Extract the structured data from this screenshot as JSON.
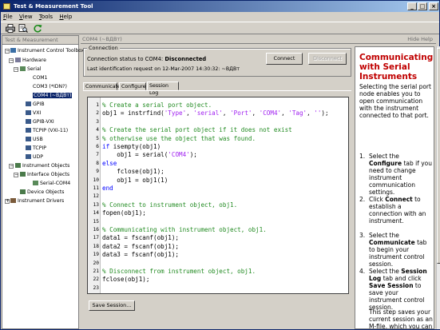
{
  "window": {
    "title": "Test & Measurement Tool",
    "controls": [
      "_",
      "□",
      "×"
    ]
  },
  "menu": [
    {
      "accel": "F",
      "rest": "ile"
    },
    {
      "accel": "V",
      "rest": "iew"
    },
    {
      "accel": "T",
      "rest": "ools"
    },
    {
      "accel": "H",
      "rest": "elp"
    }
  ],
  "toolbar": {
    "icons": [
      "print-icon",
      "print-preview-icon",
      "refresh-icon"
    ]
  },
  "left_panel": {
    "title": "Test & Measurement",
    "tree": {
      "root": "Instrument Control Toolbox",
      "hardware": "Hardware",
      "serial": "Serial",
      "com1": "COM1",
      "com3": "COM3 (*IDN?)",
      "com4": "COM4 (~ВДВт)",
      "gpib": "GPIB",
      "vxi": "VXI",
      "gpibvxi": "GPIB-VXI",
      "tcpipvxi": "TCPIP (VXI-11)",
      "usb": "USB",
      "tcpip": "TCPIP",
      "udp": "UDP",
      "instrument_objects": "Instrument Objects",
      "interface_objects": "Interface Objects",
      "serial_com4": "Serial-COM4",
      "device_objects": "Device Objects",
      "instrument_drivers": "Instrument Drivers"
    }
  },
  "right_panel": {
    "title": "COM4 (~ВДВт)",
    "hide_help": "Hide Help",
    "connection": {
      "legend": "Connection",
      "status_prefix": "Connection status to COM4:",
      "status_value": "Disconnected",
      "last_id": "Last identification request on 12-Mar-2007 14:30:32: ~ВДВт",
      "connect_label": "Connect",
      "disconnect_label": "Disconnect"
    },
    "tabs": [
      "Communicate",
      "Configure",
      "Session Log"
    ],
    "active_tab": "Session Log",
    "session_log": [
      {
        "n": "1",
        "text": "% Create a serial port object.",
        "type": "comment"
      },
      {
        "n": "2",
        "text": "obj1 = instrfind('Type', 'serial', 'Port', 'COM4', 'Tag', '');",
        "type": "code"
      },
      {
        "n": "3",
        "text": "",
        "type": "code"
      },
      {
        "n": "4",
        "text": "% Create the serial port object if it does not exist",
        "type": "comment"
      },
      {
        "n": "5",
        "text": "% otherwise use the object that was found.",
        "type": "comment"
      },
      {
        "n": "6",
        "text": "if isempty(obj1)",
        "type": "code"
      },
      {
        "n": "7",
        "text": "    obj1 = serial('COM4');",
        "type": "code"
      },
      {
        "n": "8",
        "text": "else",
        "type": "code"
      },
      {
        "n": "9",
        "text": "    fclose(obj1);",
        "type": "code"
      },
      {
        "n": "10",
        "text": "    obj1 = obj1(1)",
        "type": "code"
      },
      {
        "n": "11",
        "text": "end",
        "type": "code"
      },
      {
        "n": "12",
        "text": "",
        "type": "code"
      },
      {
        "n": "13",
        "text": "% Connect to instrument object, obj1.",
        "type": "comment"
      },
      {
        "n": "14",
        "text": "fopen(obj1);",
        "type": "code"
      },
      {
        "n": "15",
        "text": "",
        "type": "code"
      },
      {
        "n": "16",
        "text": "% Communicating with instrument object, obj1.",
        "type": "comment"
      },
      {
        "n": "17",
        "text": "data1 = fscanf(obj1);",
        "type": "code"
      },
      {
        "n": "18",
        "text": "data2 = fscanf(obj1);",
        "type": "code"
      },
      {
        "n": "19",
        "text": "data3 = fscanf(obj1);",
        "type": "code"
      },
      {
        "n": "20",
        "text": "",
        "type": "code"
      },
      {
        "n": "21",
        "text": "% Disconnect from instrument object, obj1.",
        "type": "comment"
      },
      {
        "n": "22",
        "text": "fclose(obj1);",
        "type": "code"
      },
      {
        "n": "23",
        "text": "",
        "type": "code"
      }
    ],
    "save_session_label": "Save Session..."
  },
  "help": {
    "heading": "Communicating with Serial Instruments",
    "intro": "Selecting the serial port node enables you to open communication with the instrument connected to that port.",
    "steps": [
      {
        "num": "1.",
        "parts": [
          [
            "Select the ",
            ""
          ],
          [
            "Configure",
            "b"
          ],
          [
            " tab if you need to change instrument communication settings.",
            ""
          ]
        ]
      },
      {
        "num": "2.",
        "parts": [
          [
            "Click ",
            ""
          ],
          [
            "Connect",
            "b"
          ],
          [
            " to establish a connection with an instrument.",
            ""
          ]
        ]
      },
      {
        "num": "3.",
        "parts": [
          [
            "Select the ",
            ""
          ],
          [
            "Communicate",
            "b"
          ],
          [
            " tab to begin your instrument control session.",
            ""
          ]
        ]
      },
      {
        "num": "4.",
        "parts": [
          [
            "Select the ",
            ""
          ],
          [
            "Session Log",
            "b"
          ],
          [
            " tab and click ",
            ""
          ],
          [
            "Save Session",
            "b"
          ],
          [
            " to save your instrument control session.",
            ""
          ]
        ]
      }
    ],
    "tail": "This step saves your current session as an M-file, which you can run from MATLAB..."
  },
  "colors": {
    "titlebar_start": "#0a246a",
    "titlebar_end": "#a6caf0",
    "help_heading": "#c00000",
    "comment": "#228b22",
    "string": "#a020f0",
    "keyword": "#0000ff"
  }
}
